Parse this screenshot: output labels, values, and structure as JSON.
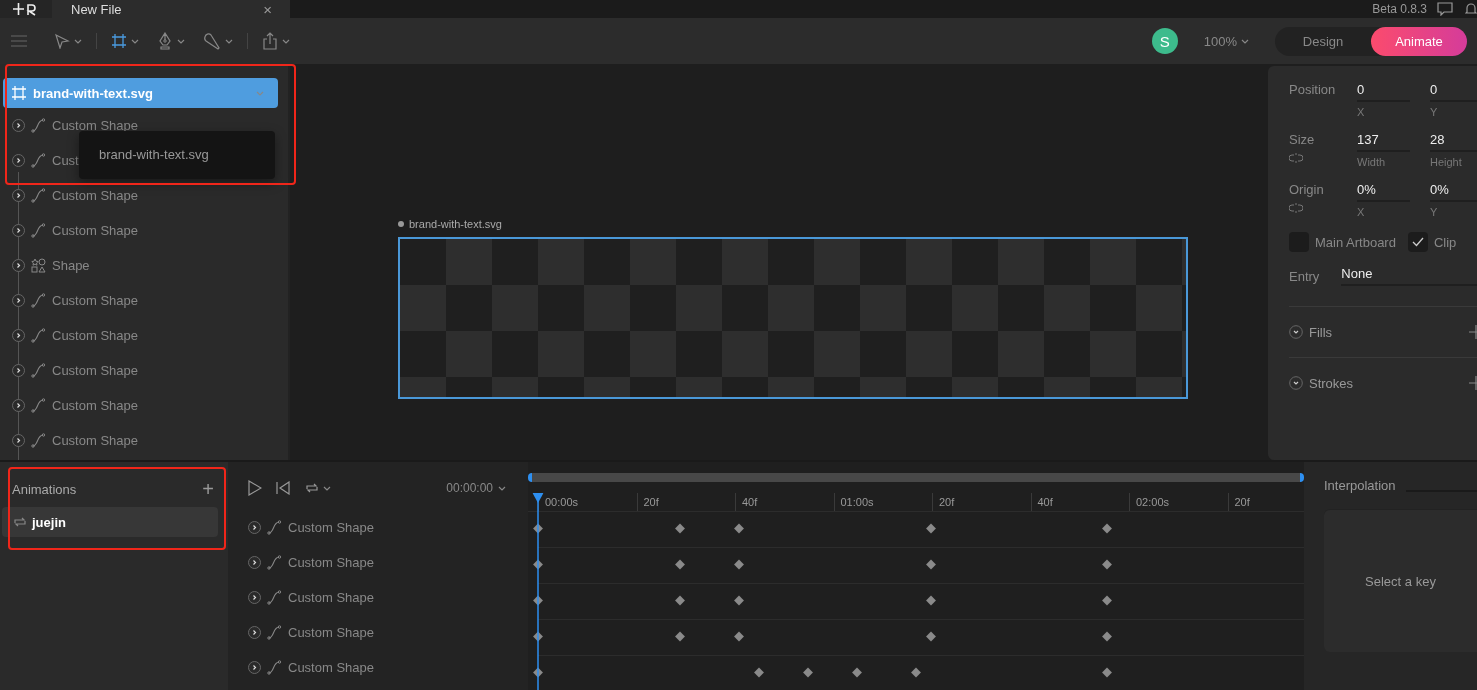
{
  "title_bar": {
    "tab": {
      "label": "New File",
      "close": "×",
      "selected": true
    },
    "version": "Beta 0.8.3"
  },
  "toolbar": {
    "tools": [
      {
        "kind": "pointer",
        "selected": false
      },
      {
        "kind": "frame",
        "selected": true
      },
      {
        "kind": "pen",
        "selected": false
      },
      {
        "kind": "brush",
        "selected": false
      },
      {
        "kind": "export",
        "selected": false
      }
    ],
    "avatar": "S",
    "zoom": "100%",
    "modes": [
      {
        "label": "Design",
        "selected": false
      },
      {
        "label": "Animate",
        "selected": true
      }
    ]
  },
  "layers": {
    "rows": [
      {
        "kind": "artboard",
        "label": "brand-with-text.svg",
        "selected": true
      },
      {
        "kind": "custom",
        "label": "Custom Shape",
        "selected": false
      },
      {
        "kind": "custom",
        "label": "Cust",
        "selected": false
      },
      {
        "kind": "custom",
        "label": "Custom Shape",
        "selected": false
      },
      {
        "kind": "custom",
        "label": "Custom Shape",
        "selected": false
      },
      {
        "kind": "shape",
        "label": "Shape",
        "selected": false
      },
      {
        "kind": "custom",
        "label": "Custom Shape",
        "selected": false
      },
      {
        "kind": "custom",
        "label": "Custom Shape",
        "selected": false
      },
      {
        "kind": "custom",
        "label": "Custom Shape",
        "selected": false
      },
      {
        "kind": "custom",
        "label": "Custom Shape",
        "selected": false
      },
      {
        "kind": "custom",
        "label": "Custom Shape",
        "selected": false
      }
    ],
    "tooltip": "brand-with-text.svg"
  },
  "canvas": {
    "artboard_label": "brand-with-text.svg"
  },
  "properties": {
    "rows": [
      {
        "label": "Position",
        "linked_icon": false,
        "fields": [
          {
            "value": "0",
            "caption": "X"
          },
          {
            "value": "0",
            "caption": "Y"
          }
        ]
      },
      {
        "label": "Size",
        "linked_icon": true,
        "fields": [
          {
            "value": "137",
            "caption": "Width"
          },
          {
            "value": "28",
            "caption": "Height"
          }
        ]
      },
      {
        "label": "Origin",
        "linked_icon": true,
        "fields": [
          {
            "value": "0%",
            "caption": "X"
          },
          {
            "value": "0%",
            "caption": "Y"
          }
        ]
      }
    ],
    "checkboxes": [
      {
        "label": "Main Artboard",
        "checked": false
      },
      {
        "label": "Clip",
        "checked": true
      }
    ],
    "entry": {
      "label": "Entry",
      "value": "None"
    },
    "sections": [
      {
        "label": "Fills"
      },
      {
        "label": "Strokes"
      }
    ]
  },
  "animations": {
    "title": "Animations",
    "add": "+",
    "items": [
      {
        "label": "juejin",
        "selected": true
      }
    ]
  },
  "timeline": {
    "time": "00:00:00",
    "ruler": [
      "00:00s",
      "20f",
      "40f",
      "01:00s",
      "20f",
      "40f",
      "02:00s",
      "20f"
    ],
    "playhead": {
      "level": 0
    },
    "rows": [
      {
        "label": "Custom Shape",
        "keyframes": [
          {
            "level": 0
          },
          {
            "level": 0.185
          },
          {
            "level": 0.262
          },
          {
            "level": 0.513
          },
          {
            "level": 0.743
          }
        ]
      },
      {
        "label": "Custom Shape",
        "keyframes": [
          {
            "level": 0
          },
          {
            "level": 0.185
          },
          {
            "level": 0.262
          },
          {
            "level": 0.513
          },
          {
            "level": 0.743
          }
        ]
      },
      {
        "label": "Custom Shape",
        "keyframes": [
          {
            "level": 0
          },
          {
            "level": 0.185
          },
          {
            "level": 0.262
          },
          {
            "level": 0.513
          },
          {
            "level": 0.743
          }
        ]
      },
      {
        "label": "Custom Shape",
        "keyframes": [
          {
            "level": 0
          },
          {
            "level": 0.185
          },
          {
            "level": 0.262
          },
          {
            "level": 0.513
          },
          {
            "level": 0.743
          }
        ]
      },
      {
        "label": "Custom Shape",
        "keyframes": [
          {
            "level": 0
          },
          {
            "level": 0.289
          },
          {
            "level": 0.352
          },
          {
            "level": 0.416
          },
          {
            "level": 0.493
          },
          {
            "level": 0.743
          }
        ]
      }
    ]
  },
  "interpolation": {
    "title": "Interpolation",
    "message": "Select a key"
  }
}
